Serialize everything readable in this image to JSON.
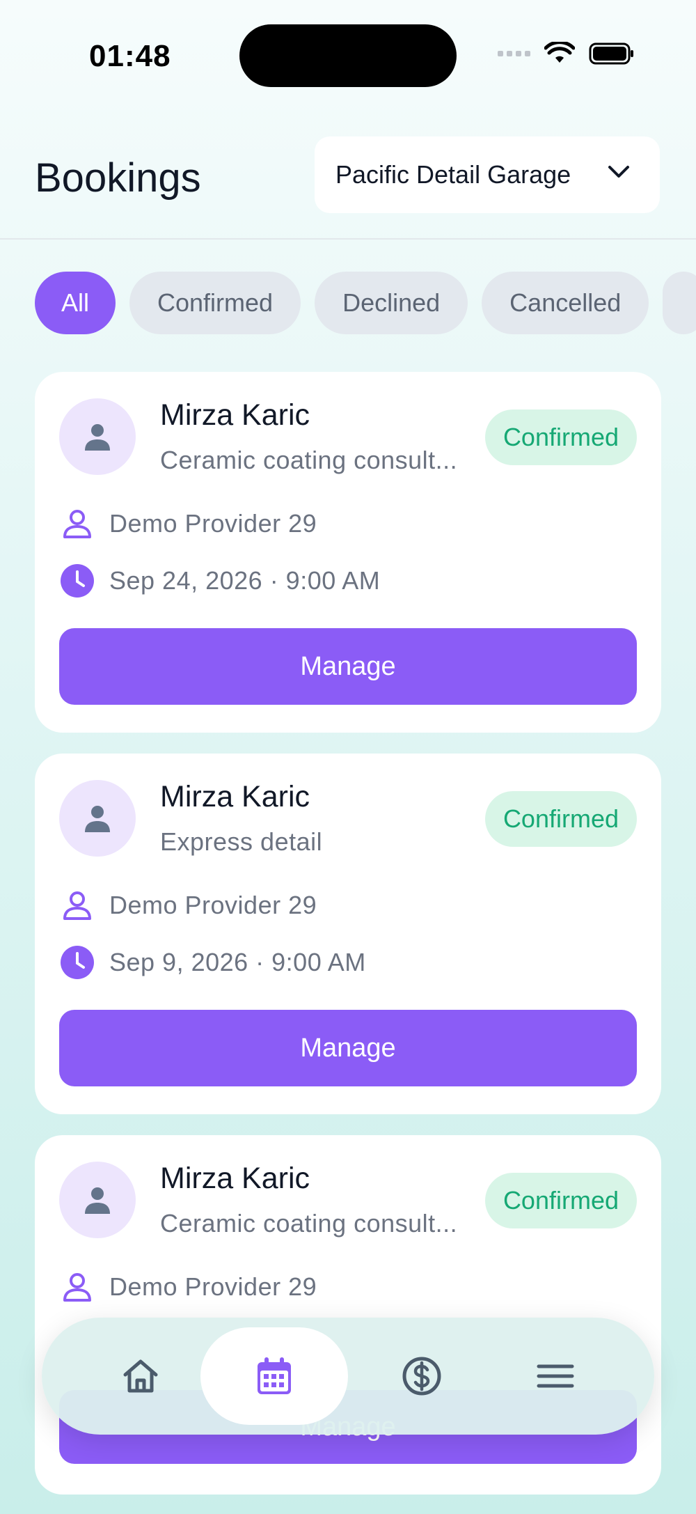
{
  "status": {
    "time": "01:48"
  },
  "header": {
    "title": "Bookings",
    "garage": "Pacific Detail Garage"
  },
  "filters": [
    {
      "label": "All",
      "active": true
    },
    {
      "label": "Confirmed",
      "active": false
    },
    {
      "label": "Declined",
      "active": false
    },
    {
      "label": "Cancelled",
      "active": false
    }
  ],
  "bookings": [
    {
      "customer": "Mirza Karic",
      "service": "Ceramic coating consult...",
      "status": "Confirmed",
      "provider": "Demo Provider 29",
      "datetime": "Sep 24, 2026 · 9:00 AM",
      "action": "Manage"
    },
    {
      "customer": "Mirza Karic",
      "service": "Express detail",
      "status": "Confirmed",
      "provider": "Demo Provider 29",
      "datetime": "Sep 9, 2026 · 9:00 AM",
      "action": "Manage"
    },
    {
      "customer": "Mirza Karic",
      "service": "Ceramic coating consult...",
      "status": "Confirmed",
      "provider": "Demo Provider 29",
      "datetime": "",
      "action": "Manage"
    }
  ],
  "nav": [
    {
      "icon": "home-icon",
      "active": false
    },
    {
      "icon": "calendar-icon",
      "active": true
    },
    {
      "icon": "dollar-icon",
      "active": false
    },
    {
      "icon": "menu-icon",
      "active": false
    }
  ],
  "colors": {
    "accent": "#8b5cf6",
    "confirmed_bg": "#d8f5e7",
    "confirmed_text": "#16a874",
    "chip_bg": "#e3e8ee"
  }
}
